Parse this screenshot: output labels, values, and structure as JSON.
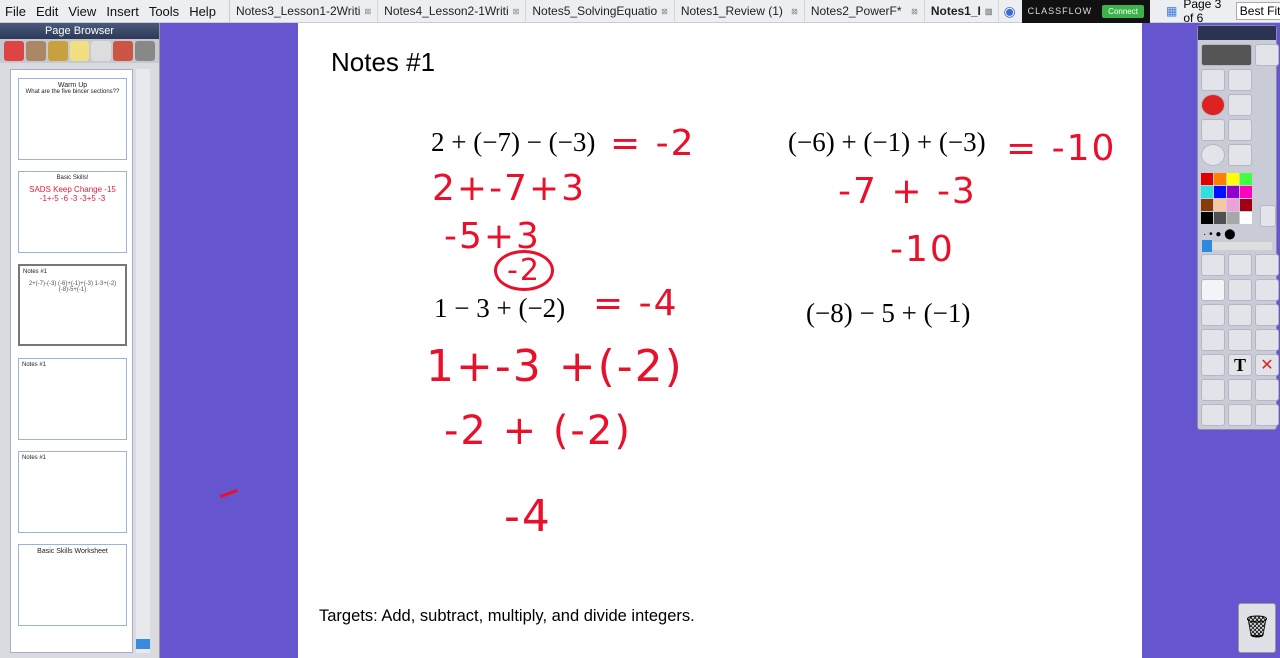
{
  "menu": [
    "File",
    "Edit",
    "View",
    "Insert",
    "Tools",
    "Help"
  ],
  "tabs": [
    {
      "label": "Notes3_Lesson1-2Writi"
    },
    {
      "label": "Notes4_Lesson2-1Writi"
    },
    {
      "label": "Notes5_SolvingEquatio"
    },
    {
      "label": "Notes1_Review (1)"
    },
    {
      "label": "Notes2_PowerF*"
    },
    {
      "label": "Notes1_I",
      "active": true
    }
  ],
  "classflow": {
    "brand": "CLASSFLOW",
    "connect": "Connect"
  },
  "page_info": "Page 3 of 6",
  "zoom": "Best Fit",
  "page_browser": {
    "title": "Page Browser",
    "thumbs": [
      {
        "title": "Warm Up",
        "text": "What are the five bincer sections??"
      },
      {
        "title": "Basic Skills!",
        "ink": "SADS   Keep Change  -15   -1+-5  -6   -3   -3+5  -3"
      },
      {
        "title": "Notes #1",
        "text": "2+(-7)-(-3)   (-6)+(-1)+(-3)   1-3+(-2)   (-8)-5+(-1)"
      },
      {
        "title": "Notes #1",
        "text": ""
      },
      {
        "title": "Notes #1",
        "text": ""
      },
      {
        "title": "Basic Skills Worksheet",
        "text": ""
      }
    ]
  },
  "page": {
    "title": "Notes #1",
    "problems": [
      "2 + (−7) − (−3)",
      "(−6) + (−1) + (−3)",
      "1 − 3 + (−2)",
      "(−8) − 5 + (−1)"
    ],
    "ink": {
      "p1": [
        "= -2",
        "2+-7+3",
        "-5+3",
        "-2"
      ],
      "p2": [
        "= -10",
        "-7 + -3",
        "-10"
      ],
      "p3": [
        "= -4",
        "1+-3 +(-2)",
        "-2 + (-2)",
        "-4"
      ]
    },
    "targets": "Targets: Add, subtract, multiply, and divide integers."
  },
  "toolbox": {
    "palette": [
      "#e00000",
      "#ff8000",
      "#ffff00",
      "#40ff40",
      "#30e0e0",
      "#0010ff",
      "#9000d0",
      "#ff00c0",
      "#8a3a0a",
      "#f4c8a0",
      "#f0a0d8",
      "#a00010",
      "#000000",
      "#505050",
      "#a8a8a8",
      "#ffffff"
    ]
  },
  "accent": "#e8102a"
}
